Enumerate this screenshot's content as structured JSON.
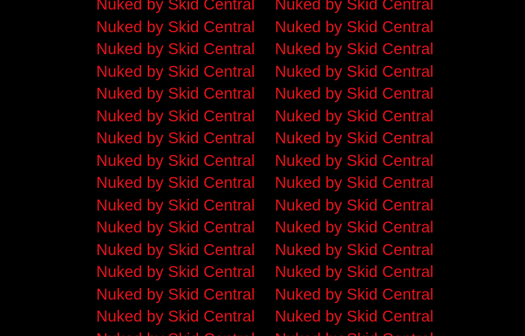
{
  "background_color": "#000000",
  "text_color": "#e8141c",
  "rows": [
    [
      "Nuked by Skid Central",
      "Nuked by Skid Central"
    ],
    [
      "Nuked by Skid Central",
      "Nuked by Skid Central"
    ],
    [
      "Nuked by Skid Central",
      "Nuked by Skid Central"
    ],
    [
      "Nuked by Skid Central",
      "Nuked by Skid Central"
    ],
    [
      "Nuked by Skid Central",
      "Nuked by Skid Central"
    ],
    [
      "Nuked by Skid Central",
      "Nuked by Skid Central"
    ],
    [
      "Nuked by Skid Central",
      "Nuked by Skid Central"
    ],
    [
      "Nuked by Skid Central",
      "Nuked by Skid Central"
    ],
    [
      "Nuked by Skid Central",
      "Nuked by Skid Central"
    ],
    [
      "Nuked by Skid Central",
      "Nuked by Skid Central"
    ],
    [
      "Nuked by Skid Central",
      "Nuked by Skid Central"
    ],
    [
      "Nuked by Skid Central",
      "Nuked by Skid Central"
    ],
    [
      "Nuked by Skid Central",
      "Nuked by Skid Central"
    ],
    [
      "Nuked by Skid Central",
      "Nuked by Skid Central"
    ],
    [
      "Nuked by Skid Central",
      "Nuked by Skid Central"
    ],
    [
      "Nuked by Skid Central",
      "Nuked by Skid Central"
    ]
  ]
}
